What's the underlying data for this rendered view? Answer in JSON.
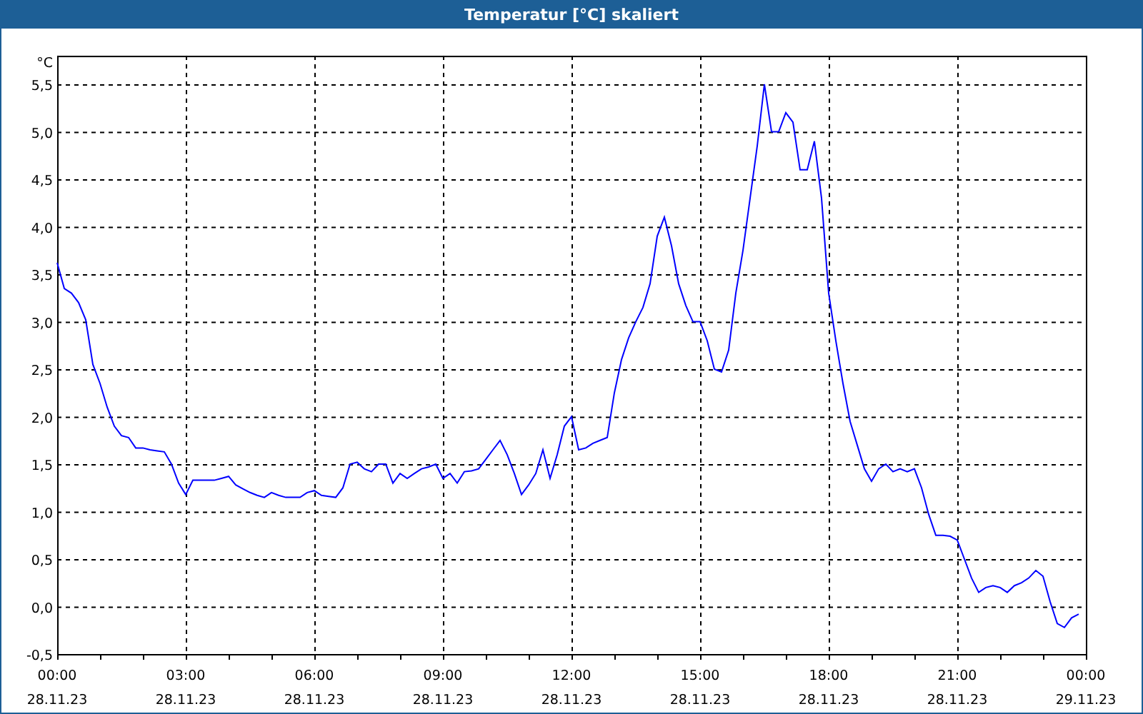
{
  "window": {
    "title": "Temperatur [°C] skaliert"
  },
  "chart": {
    "chart_data": {
      "type": "line",
      "ylabel": "°C",
      "grid": true,
      "ylim": [
        -0.5,
        5.8
      ],
      "yticks": [
        {
          "value": -0.5,
          "label": "-0,5"
        },
        {
          "value": 0,
          "label": "0,0"
        },
        {
          "value": 0.5,
          "label": "0,5"
        },
        {
          "value": 1,
          "label": "1,0"
        },
        {
          "value": 1.5,
          "label": "1,5"
        },
        {
          "value": 2,
          "label": "2,0"
        },
        {
          "value": 2.5,
          "label": "2,5"
        },
        {
          "value": 3,
          "label": "3,0"
        },
        {
          "value": 3.5,
          "label": "3,5"
        },
        {
          "value": 4,
          "label": "4,0"
        },
        {
          "value": 4.5,
          "label": "4,5"
        },
        {
          "value": 5,
          "label": "5,0"
        },
        {
          "value": 5.5,
          "label": "5,5"
        }
      ],
      "categories": [
        "00:00\n28.11.23",
        null,
        null,
        null,
        null,
        null,
        null,
        null,
        null,
        null,
        null,
        null,
        null,
        null,
        null,
        null,
        null,
        null,
        "03:00\n28.11.23",
        null,
        null,
        null,
        null,
        null,
        null,
        null,
        null,
        null,
        null,
        null,
        null,
        null,
        null,
        null,
        null,
        null,
        "06:00\n28.11.23",
        null,
        null,
        null,
        null,
        null,
        null,
        null,
        null,
        null,
        null,
        null,
        null,
        null,
        null,
        null,
        null,
        null,
        "09:00\n28.11.23",
        null,
        null,
        null,
        null,
        null,
        null,
        null,
        null,
        null,
        null,
        null,
        null,
        null,
        null,
        null,
        null,
        null,
        "12:00\n28.11.23",
        null,
        null,
        null,
        null,
        null,
        null,
        null,
        null,
        null,
        null,
        null,
        null,
        null,
        null,
        null,
        null,
        null,
        "15:00\n28.11.23",
        null,
        null,
        null,
        null,
        null,
        null,
        null,
        null,
        null,
        null,
        null,
        null,
        null,
        null,
        null,
        null,
        null,
        "18:00\n28.11.23",
        null,
        null,
        null,
        null,
        null,
        null,
        null,
        null,
        null,
        null,
        null,
        null,
        null,
        null,
        null,
        null,
        null,
        "21:00\n28.11.23",
        null,
        null,
        null,
        null,
        null,
        null,
        null,
        null,
        null,
        null,
        null,
        null,
        null,
        null,
        null,
        null,
        null,
        "00:00\n29.11.23"
      ],
      "series": [
        {
          "color": "#0000ff",
          "values": [
            3.62,
            3.35,
            3.3,
            3.2,
            3.02,
            2.55,
            2.35,
            2.1,
            1.9,
            1.8,
            1.78,
            1.67,
            1.67,
            1.65,
            1.64,
            1.63,
            1.5,
            1.3,
            1.18,
            1.33,
            1.33,
            1.33,
            1.33,
            1.35,
            1.37,
            1.28,
            1.24,
            1.2,
            1.17,
            1.15,
            1.2,
            1.17,
            1.15,
            1.15,
            1.15,
            1.2,
            1.22,
            1.17,
            1.16,
            1.15,
            1.25,
            1.5,
            1.52,
            1.45,
            1.42,
            1.5,
            1.5,
            1.3,
            1.4,
            1.35,
            1.4,
            1.45,
            1.47,
            1.5,
            1.35,
            1.4,
            1.3,
            1.42,
            1.43,
            1.45,
            1.55,
            1.65,
            1.75,
            1.6,
            1.4,
            1.18,
            1.28,
            1.4,
            1.65,
            1.35,
            1.6,
            1.9,
            2.0,
            1.65,
            1.67,
            1.72,
            1.75,
            1.78,
            2.25,
            2.6,
            2.83,
            3.0,
            3.15,
            3.4,
            3.9,
            4.1,
            3.8,
            3.4,
            3.17,
            3.0,
            3.0,
            2.8,
            2.5,
            2.47,
            2.7,
            3.3,
            3.75,
            4.3,
            4.85,
            5.5,
            5.0,
            5.0,
            5.2,
            5.1,
            4.6,
            4.6,
            4.9,
            4.3,
            3.3,
            2.8,
            2.35,
            1.95,
            1.7,
            1.45,
            1.32,
            1.45,
            1.5,
            1.42,
            1.45,
            1.42,
            1.45,
            1.25,
            0.97,
            0.75,
            0.75,
            0.74,
            0.7,
            0.5,
            0.3,
            0.15,
            0.2,
            0.22,
            0.2,
            0.15,
            0.22,
            0.25,
            0.3,
            0.38,
            0.32,
            0.05,
            -0.18,
            -0.22,
            -0.12,
            -0.08,
            null
          ]
        }
      ]
    }
  }
}
